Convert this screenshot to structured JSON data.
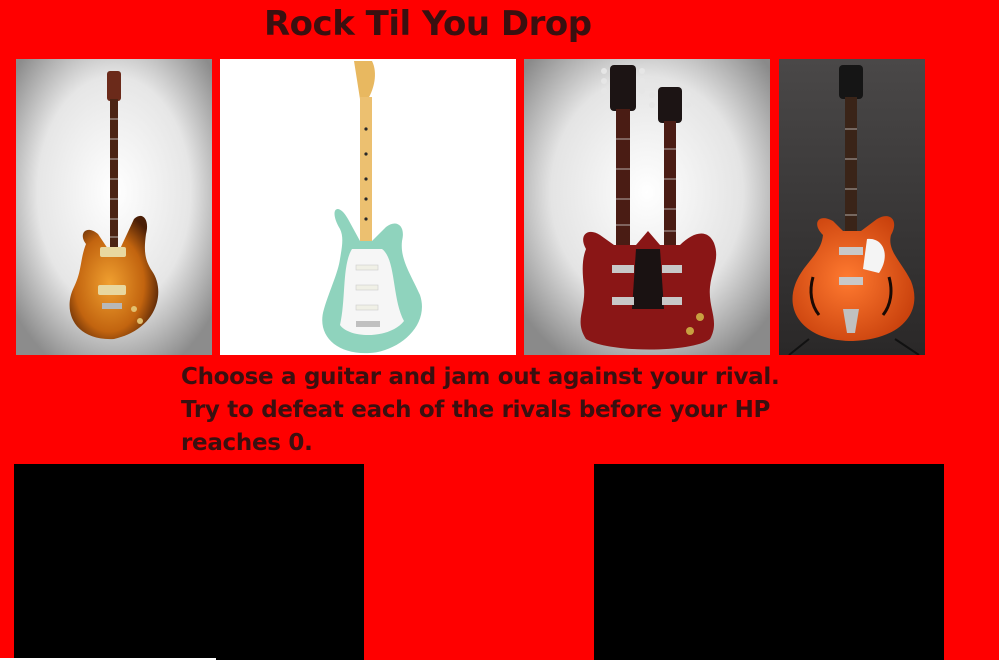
{
  "header": {
    "title": "Rock Til You Drop"
  },
  "guitars": [
    {
      "icon": "sunburst-electric-guitar-icon",
      "color": "#c86a12"
    },
    {
      "icon": "seafoam-green-stratocaster-icon",
      "color": "#8fd3bd"
    },
    {
      "icon": "red-double-neck-guitar-icon",
      "color": "#8a1616"
    },
    {
      "icon": "orange-hollow-body-guitar-icon",
      "color": "#e8561a"
    }
  ],
  "instructions": {
    "line1": "Choose a guitar and jam out against your rival.",
    "line2": "Try to defeat each of the rivals before your HP reaches 0."
  },
  "colors": {
    "background": "#ff0000",
    "text": "#3a1010",
    "panel": "#000000"
  }
}
